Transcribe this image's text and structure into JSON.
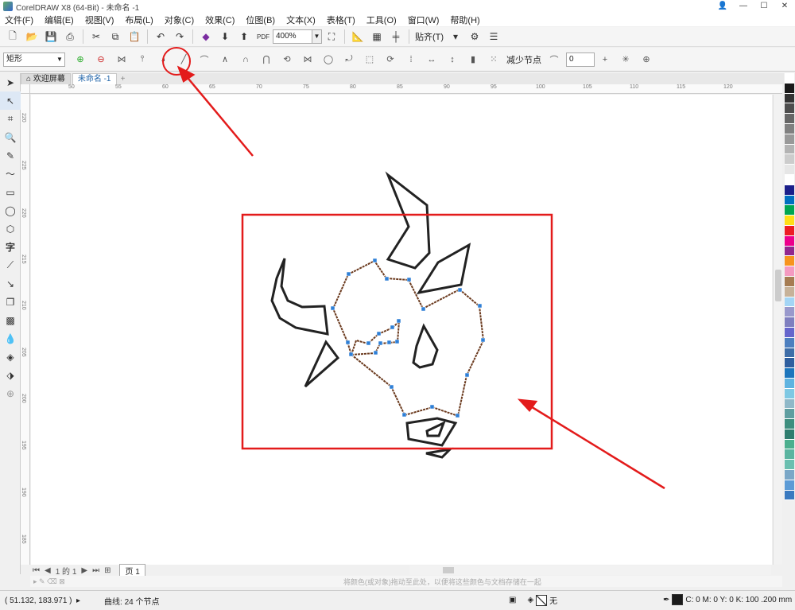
{
  "window": {
    "title": "CorelDRAW X8 (64-Bit) - 未命名 -1"
  },
  "menu": [
    "文件(F)",
    "编辑(E)",
    "视图(V)",
    "布局(L)",
    "对象(C)",
    "效果(C)",
    "位图(B)",
    "文本(X)",
    "表格(T)",
    "工具(O)",
    "窗口(W)",
    "帮助(H)"
  ],
  "toolbar": {
    "zoom": "400%",
    "snap_label": "贴齐(T)",
    "pdf_label": "PDF"
  },
  "property_bar": {
    "shape_type": "矩形",
    "reduce_nodes": "减少节点",
    "smoothness": "0"
  },
  "tabs": {
    "welcome": "欢迎屏幕",
    "doc": "未命名 -1"
  },
  "ruler": {
    "h_labels": [
      "50",
      "55",
      "60",
      "65",
      "70",
      "75",
      "80",
      "85",
      "90",
      "95",
      "100",
      "105",
      "110",
      "115",
      "120"
    ],
    "v_labels": [
      "220",
      "225",
      "220",
      "215",
      "210",
      "205",
      "200",
      "195",
      "190",
      "185"
    ]
  },
  "pagenav": {
    "page_count": "1 的 1",
    "page_tab": "页 1"
  },
  "hint": "将颜色(或对象)拖动至此处，以便将这些颜色与文档存储在一起",
  "status": {
    "coordinates": "( 51.132, 183.971 )",
    "info": "曲线: 24 个节点",
    "fill": "无",
    "outline": "C: 0 M: 0 Y: 0 K: 100  .200 mm"
  },
  "colors": {
    "annotation": "#e31b1b",
    "node": "#2e7fd6",
    "stroke": "#222222",
    "accent": "#1f63a8"
  },
  "palette": [
    "#ffffff",
    "#1a1a1a",
    "#333333",
    "#4d4d4d",
    "#666666",
    "#808080",
    "#999999",
    "#b3b3b3",
    "#cccccc",
    "#e6e6e6",
    "#ffffff",
    "#1b1f8a",
    "#0070c0",
    "#00a651",
    "#ffde17",
    "#ed1c24",
    "#ec008c",
    "#92278f",
    "#f7941d",
    "#f49ac1",
    "#a67c52",
    "#c7b299",
    "#a3d5f5",
    "#9999cc",
    "#7f7fbf",
    "#6666cc",
    "#4d7fbf",
    "#3f6ea8",
    "#2f5f9f",
    "#1c75bc",
    "#5fb3e0",
    "#7ec8e3",
    "#8fb8c8",
    "#5f9ea0",
    "#3e8e7e",
    "#2e7d6e",
    "#4caf8e",
    "#5ab4a0",
    "#6bbfb0",
    "#7aa7c7",
    "#5c9bd6",
    "#3a7ac0"
  ]
}
